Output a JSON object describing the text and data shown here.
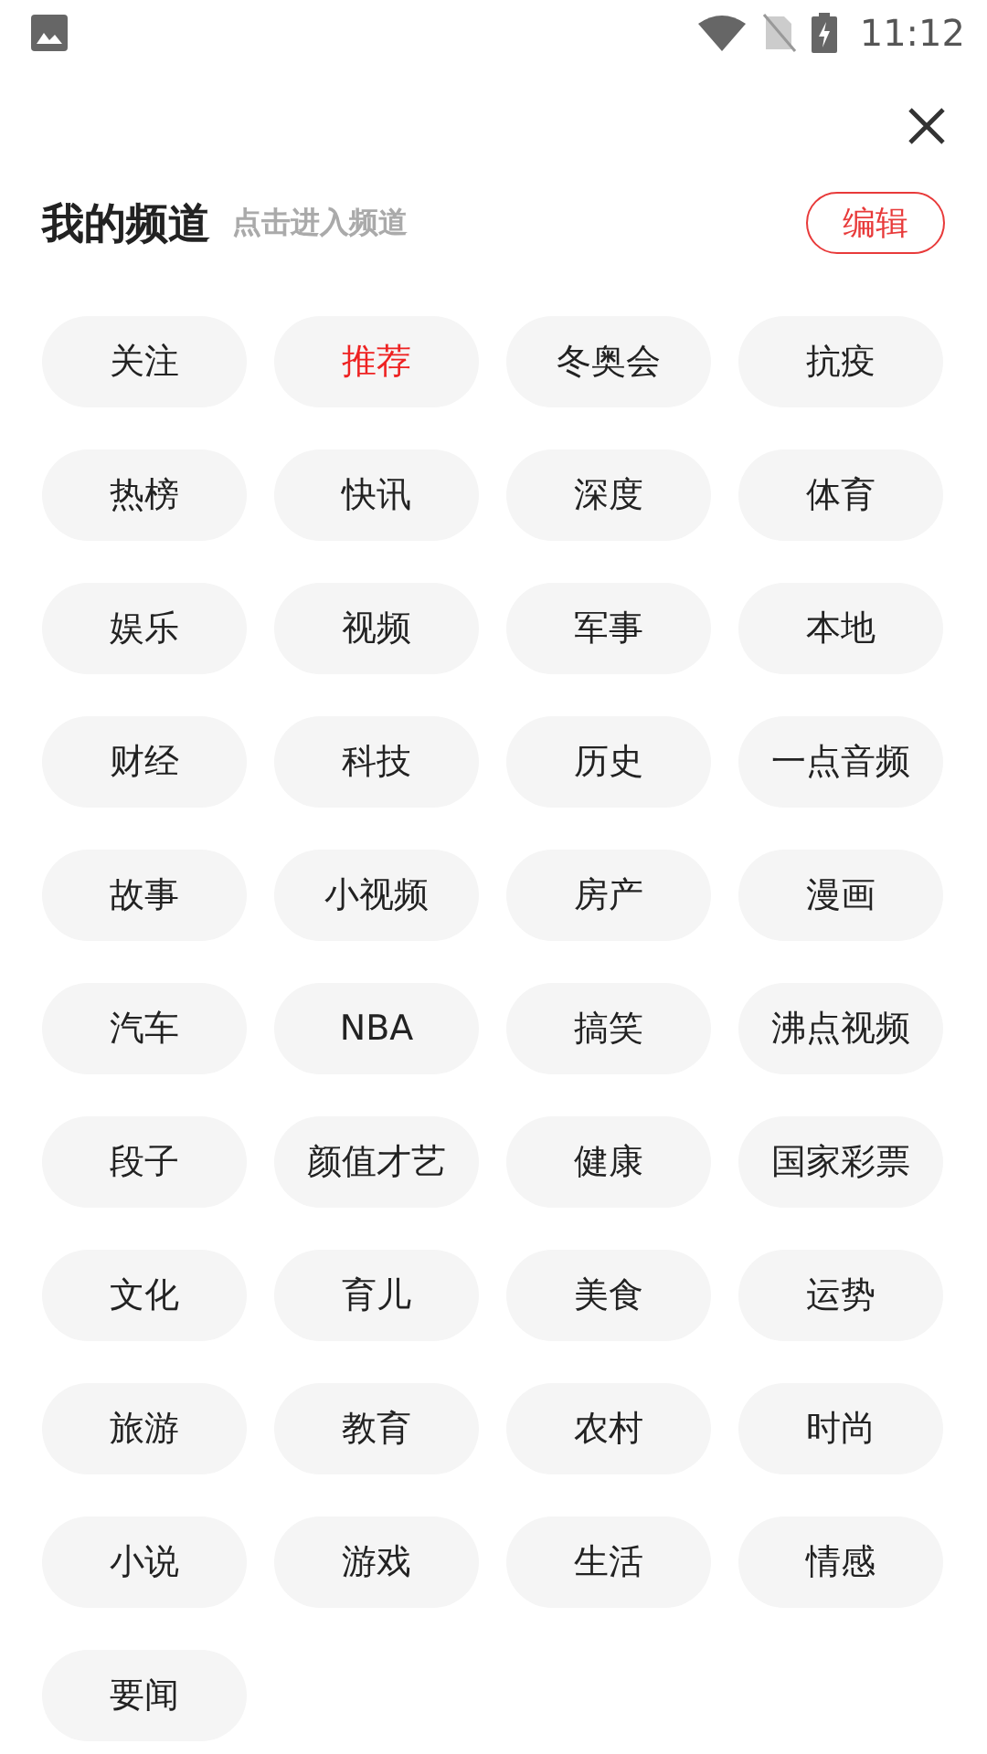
{
  "status_bar": {
    "time": "11:12"
  },
  "header": {
    "title": "我的频道",
    "hint": "点击进入频道",
    "edit_button": "编辑"
  },
  "channels": [
    {
      "label": "关注",
      "selected": false
    },
    {
      "label": "推荐",
      "selected": true
    },
    {
      "label": "冬奥会",
      "selected": false
    },
    {
      "label": "抗疫",
      "selected": false
    },
    {
      "label": "热榜",
      "selected": false
    },
    {
      "label": "快讯",
      "selected": false
    },
    {
      "label": "深度",
      "selected": false
    },
    {
      "label": "体育",
      "selected": false
    },
    {
      "label": "娱乐",
      "selected": false
    },
    {
      "label": "视频",
      "selected": false
    },
    {
      "label": "军事",
      "selected": false
    },
    {
      "label": "本地",
      "selected": false
    },
    {
      "label": "财经",
      "selected": false
    },
    {
      "label": "科技",
      "selected": false
    },
    {
      "label": "历史",
      "selected": false
    },
    {
      "label": "一点音频",
      "selected": false
    },
    {
      "label": "故事",
      "selected": false
    },
    {
      "label": "小视频",
      "selected": false
    },
    {
      "label": "房产",
      "selected": false
    },
    {
      "label": "漫画",
      "selected": false
    },
    {
      "label": "汽车",
      "selected": false
    },
    {
      "label": "NBA",
      "selected": false
    },
    {
      "label": "搞笑",
      "selected": false
    },
    {
      "label": "沸点视频",
      "selected": false
    },
    {
      "label": "段子",
      "selected": false
    },
    {
      "label": "颜值才艺",
      "selected": false
    },
    {
      "label": "健康",
      "selected": false
    },
    {
      "label": "国家彩票",
      "selected": false
    },
    {
      "label": "文化",
      "selected": false
    },
    {
      "label": "育儿",
      "selected": false
    },
    {
      "label": "美食",
      "selected": false
    },
    {
      "label": "运势",
      "selected": false
    },
    {
      "label": "旅游",
      "selected": false
    },
    {
      "label": "教育",
      "selected": false
    },
    {
      "label": "农村",
      "selected": false
    },
    {
      "label": "时尚",
      "selected": false
    },
    {
      "label": "小说",
      "selected": false
    },
    {
      "label": "游戏",
      "selected": false
    },
    {
      "label": "生活",
      "selected": false
    },
    {
      "label": "情感",
      "selected": false
    },
    {
      "label": "要闻",
      "selected": false
    }
  ]
}
